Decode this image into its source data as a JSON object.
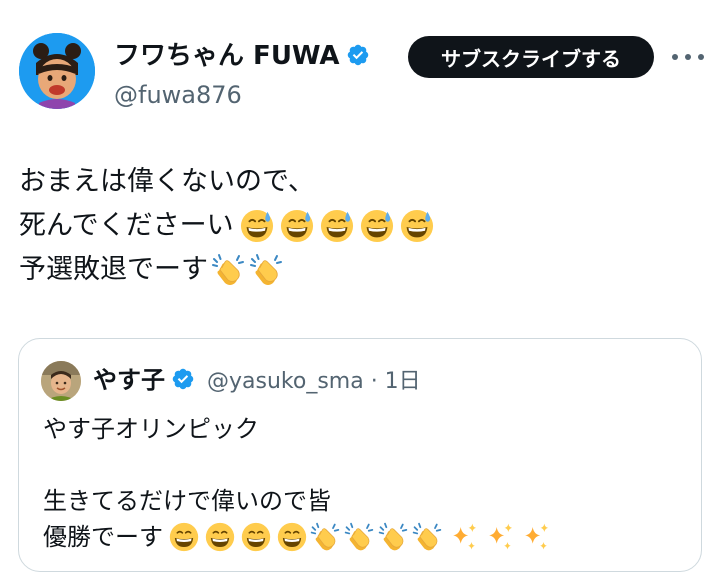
{
  "author": {
    "display_name": "フワちゃん FUWA",
    "handle": "@fuwa876",
    "avatar_icon": "avatar-photo",
    "verified_icon": "verified-badge-icon"
  },
  "actions": {
    "subscribe_label": "サブスクライブする",
    "more_icon": "more-options-icon"
  },
  "tweet": {
    "line1": "おまえは偉くないので、",
    "line2": "死んでくださーい",
    "line2_emoji": [
      "grinning-sweat-emoji",
      "grinning-sweat-emoji",
      "grinning-sweat-emoji",
      "grinning-sweat-emoji",
      "grinning-sweat-emoji"
    ],
    "line3": "予選敗退でーす",
    "line3_emoji": [
      "clapping-hands-emoji",
      "clapping-hands-emoji"
    ]
  },
  "quoted": {
    "display_name": "やす子",
    "handle_time": "@yasuko_sma · 1日",
    "line1": "やす子オリンピック",
    "line2": "生きてるだけで偉いので皆",
    "line3": "優勝でーす",
    "line3_emoji": [
      "grinning-emoji",
      "grinning-emoji",
      "grinning-emoji",
      "grinning-emoji",
      "clapping-hands-emoji",
      "clapping-hands-emoji",
      "clapping-hands-emoji",
      "clapping-hands-emoji",
      "sparkles-emoji",
      "sparkles-emoji",
      "sparkles-emoji"
    ]
  },
  "colors": {
    "verified_blue": "#1d9bf0",
    "secondary_text": "#536471",
    "button_black": "#0f1419",
    "border": "#cfd9de"
  }
}
